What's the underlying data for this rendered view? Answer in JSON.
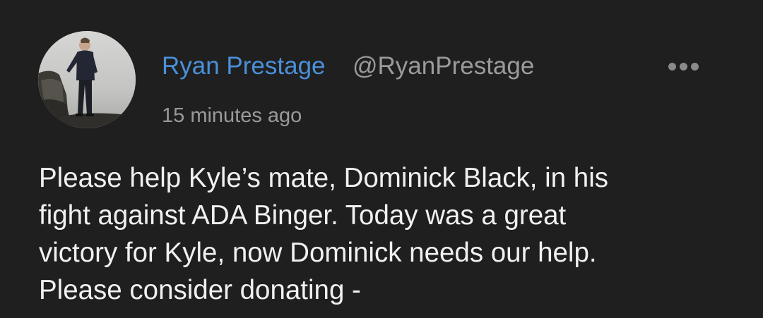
{
  "post": {
    "author_name": "Ryan Prestage",
    "author_handle": "@RyanPrestage",
    "timestamp": "15 minutes ago",
    "body_lines": [
      "Please help Kyle’s mate, Dominick Black, in his",
      "fight against ADA Binger. Today was a great",
      "victory for Kyle, now Dominick needs our help.",
      "Please consider donating -"
    ],
    "more_icon": "more-horizontal-icon",
    "avatar_icon": "avatar-photo"
  },
  "colors": {
    "background": "#1f1f1f",
    "author_name": "#4a90d9",
    "muted_text": "#9b9b9b",
    "body_text": "#f0f0f0"
  }
}
